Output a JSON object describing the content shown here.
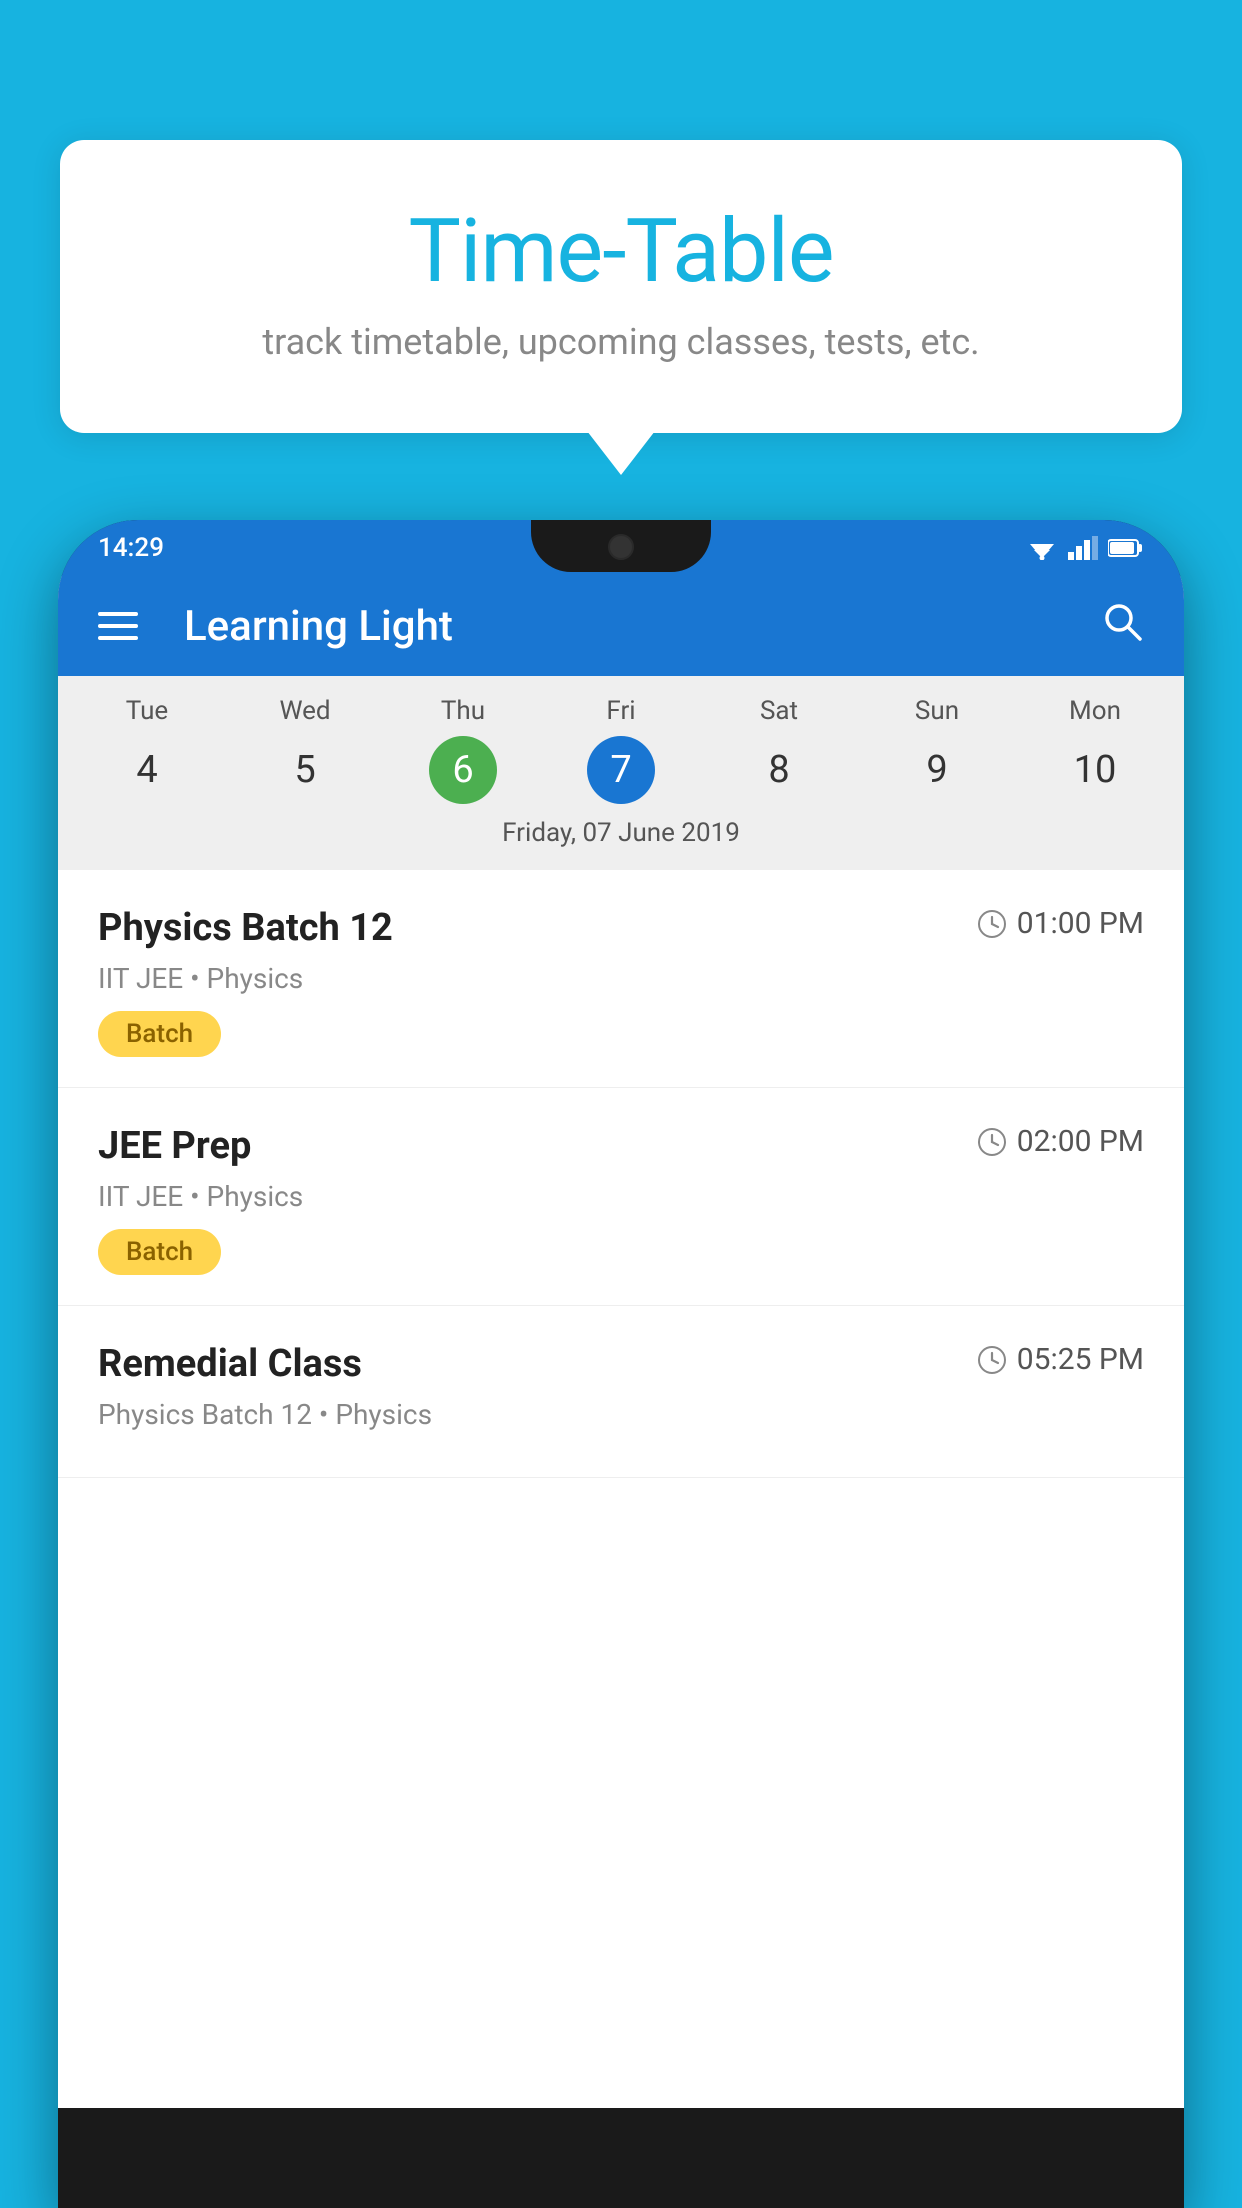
{
  "background": {
    "color": "#17b3e0"
  },
  "tooltip": {
    "title": "Time-Table",
    "subtitle": "track timetable, upcoming classes, tests, etc."
  },
  "phone": {
    "statusBar": {
      "time": "14:29"
    },
    "appBar": {
      "title": "Learning Light"
    },
    "calendar": {
      "days": [
        {
          "label": "Tue",
          "num": "4",
          "state": "normal"
        },
        {
          "label": "Wed",
          "num": "5",
          "state": "normal"
        },
        {
          "label": "Thu",
          "num": "6",
          "state": "today"
        },
        {
          "label": "Fri",
          "num": "7",
          "state": "selected"
        },
        {
          "label": "Sat",
          "num": "8",
          "state": "normal"
        },
        {
          "label": "Sun",
          "num": "9",
          "state": "normal"
        },
        {
          "label": "Mon",
          "num": "10",
          "state": "normal"
        }
      ],
      "selectedDate": "Friday, 07 June 2019"
    },
    "schedule": [
      {
        "title": "Physics Batch 12",
        "time": "01:00 PM",
        "sub": "IIT JEE • Physics",
        "badge": "Batch"
      },
      {
        "title": "JEE Prep",
        "time": "02:00 PM",
        "sub": "IIT JEE • Physics",
        "badge": "Batch"
      },
      {
        "title": "Remedial Class",
        "time": "05:25 PM",
        "sub": "Physics Batch 12 • Physics",
        "badge": ""
      }
    ]
  }
}
